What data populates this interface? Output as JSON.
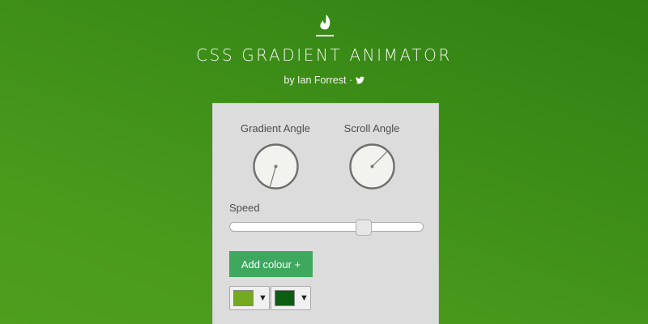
{
  "header": {
    "logo_icon": "flame-icon",
    "title": "CSS GRADIENT ANIMATOR",
    "byline": "by Ian Forrest · ",
    "twitter_icon": "twitter-icon"
  },
  "panel": {
    "gradient_angle_label": "Gradient Angle",
    "scroll_angle_label": "Scroll Angle",
    "speed_label": "Speed",
    "speed_value_fraction": 0.69,
    "add_colour_label": "Add colour +",
    "colours": [
      {
        "color": "#75aa20"
      },
      {
        "color": "#0c5c12"
      }
    ],
    "dropdown_arrow": "▼"
  },
  "colors": {
    "accent_button": "#3ea85f",
    "panel_background": "#dcdcdc"
  }
}
